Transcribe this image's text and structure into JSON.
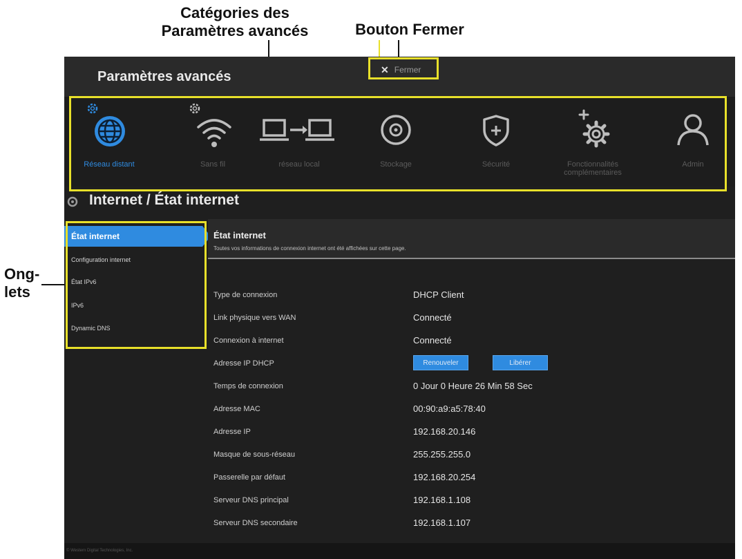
{
  "annotations": {
    "categories_label_line1": "Catégories des",
    "categories_label_line2": "Paramètres avancés",
    "close_label": "Bouton Fermer",
    "tabs_label_line1": "Ong-",
    "tabs_label_line2": "lets",
    "highlight_color": "#e8e02a"
  },
  "app": {
    "title": "Paramètres avancés",
    "close_label": "Fermer",
    "close_symbol": "✕"
  },
  "categories": [
    {
      "label": "Réseau distant",
      "icon": "globe-icon",
      "active": true
    },
    {
      "label": "Sans fil",
      "icon": "wifi-icon"
    },
    {
      "label": "réseau local",
      "icon": "lan-icon"
    },
    {
      "label": "Stockage",
      "icon": "storage-icon"
    },
    {
      "label": "Sécurité",
      "icon": "shield-icon"
    },
    {
      "label": "Fonctionnalités complémentaires",
      "icon": "gear-plus-icon"
    },
    {
      "label": "Admin",
      "icon": "user-icon"
    }
  ],
  "section": {
    "title": "Internet / État internet"
  },
  "tabs": [
    {
      "label": "État internet",
      "active": true
    },
    {
      "label": "Configuration internet"
    },
    {
      "label": "État IPv6"
    },
    {
      "label": "IPv6"
    },
    {
      "label": "Dynamic DNS"
    }
  ],
  "content": {
    "title": "État internet",
    "description": "Toutes vos informations de connexion internet ont été affichées sur cette page.",
    "rows": [
      {
        "key": "Type de connexion",
        "value": "DHCP Client"
      },
      {
        "key": "Link physique vers WAN",
        "value": "Connecté"
      },
      {
        "key": "Connexion à internet",
        "value": "Connecté"
      },
      {
        "key": "Adresse IP DHCP",
        "value": ""
      },
      {
        "key": "Temps de connexion",
        "value": "0 Jour 0 Heure 26 Min 58 Sec"
      },
      {
        "key": "Adresse MAC",
        "value": "00:90:a9:a5:78:40"
      },
      {
        "key": "Adresse IP",
        "value": "192.168.20.146"
      },
      {
        "key": "Masque de sous-réseau",
        "value": "255.255.255.0"
      },
      {
        "key": "Passerelle par défaut",
        "value": "192.168.20.254"
      },
      {
        "key": "Serveur DNS principal",
        "value": "192.168.1.108"
      },
      {
        "key": "Serveur DNS secondaire",
        "value": "192.168.1.107"
      }
    ],
    "renew_label": "Renouveler",
    "release_label": "Libérer"
  },
  "footer": {
    "text": "© Western Digital Technologies, Inc."
  },
  "colors": {
    "accent": "#2f8be0",
    "background": "#1f1f1f",
    "header": "#2a2a2a"
  }
}
